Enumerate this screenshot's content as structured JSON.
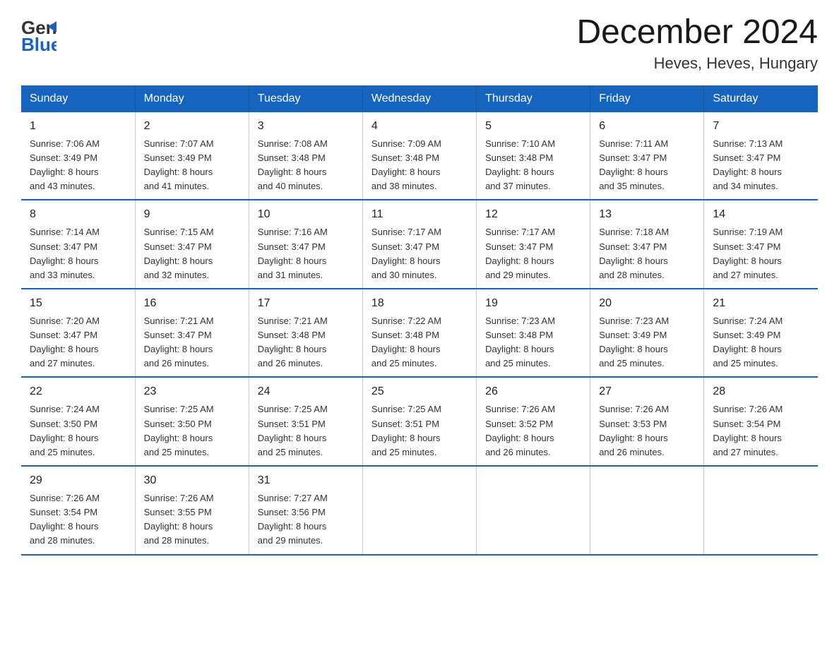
{
  "logo": {
    "line1": "General",
    "line2": "Blue"
  },
  "title": "December 2024",
  "subtitle": "Heves, Heves, Hungary",
  "columns": [
    "Sunday",
    "Monday",
    "Tuesday",
    "Wednesday",
    "Thursday",
    "Friday",
    "Saturday"
  ],
  "weeks": [
    [
      {
        "day": "1",
        "sunrise": "7:06 AM",
        "sunset": "3:49 PM",
        "daylight": "8 hours and 43 minutes."
      },
      {
        "day": "2",
        "sunrise": "7:07 AM",
        "sunset": "3:49 PM",
        "daylight": "8 hours and 41 minutes."
      },
      {
        "day": "3",
        "sunrise": "7:08 AM",
        "sunset": "3:48 PM",
        "daylight": "8 hours and 40 minutes."
      },
      {
        "day": "4",
        "sunrise": "7:09 AM",
        "sunset": "3:48 PM",
        "daylight": "8 hours and 38 minutes."
      },
      {
        "day": "5",
        "sunrise": "7:10 AM",
        "sunset": "3:48 PM",
        "daylight": "8 hours and 37 minutes."
      },
      {
        "day": "6",
        "sunrise": "7:11 AM",
        "sunset": "3:47 PM",
        "daylight": "8 hours and 35 minutes."
      },
      {
        "day": "7",
        "sunrise": "7:13 AM",
        "sunset": "3:47 PM",
        "daylight": "8 hours and 34 minutes."
      }
    ],
    [
      {
        "day": "8",
        "sunrise": "7:14 AM",
        "sunset": "3:47 PM",
        "daylight": "8 hours and 33 minutes."
      },
      {
        "day": "9",
        "sunrise": "7:15 AM",
        "sunset": "3:47 PM",
        "daylight": "8 hours and 32 minutes."
      },
      {
        "day": "10",
        "sunrise": "7:16 AM",
        "sunset": "3:47 PM",
        "daylight": "8 hours and 31 minutes."
      },
      {
        "day": "11",
        "sunrise": "7:17 AM",
        "sunset": "3:47 PM",
        "daylight": "8 hours and 30 minutes."
      },
      {
        "day": "12",
        "sunrise": "7:17 AM",
        "sunset": "3:47 PM",
        "daylight": "8 hours and 29 minutes."
      },
      {
        "day": "13",
        "sunrise": "7:18 AM",
        "sunset": "3:47 PM",
        "daylight": "8 hours and 28 minutes."
      },
      {
        "day": "14",
        "sunrise": "7:19 AM",
        "sunset": "3:47 PM",
        "daylight": "8 hours and 27 minutes."
      }
    ],
    [
      {
        "day": "15",
        "sunrise": "7:20 AM",
        "sunset": "3:47 PM",
        "daylight": "8 hours and 27 minutes."
      },
      {
        "day": "16",
        "sunrise": "7:21 AM",
        "sunset": "3:47 PM",
        "daylight": "8 hours and 26 minutes."
      },
      {
        "day": "17",
        "sunrise": "7:21 AM",
        "sunset": "3:48 PM",
        "daylight": "8 hours and 26 minutes."
      },
      {
        "day": "18",
        "sunrise": "7:22 AM",
        "sunset": "3:48 PM",
        "daylight": "8 hours and 25 minutes."
      },
      {
        "day": "19",
        "sunrise": "7:23 AM",
        "sunset": "3:48 PM",
        "daylight": "8 hours and 25 minutes."
      },
      {
        "day": "20",
        "sunrise": "7:23 AM",
        "sunset": "3:49 PM",
        "daylight": "8 hours and 25 minutes."
      },
      {
        "day": "21",
        "sunrise": "7:24 AM",
        "sunset": "3:49 PM",
        "daylight": "8 hours and 25 minutes."
      }
    ],
    [
      {
        "day": "22",
        "sunrise": "7:24 AM",
        "sunset": "3:50 PM",
        "daylight": "8 hours and 25 minutes."
      },
      {
        "day": "23",
        "sunrise": "7:25 AM",
        "sunset": "3:50 PM",
        "daylight": "8 hours and 25 minutes."
      },
      {
        "day": "24",
        "sunrise": "7:25 AM",
        "sunset": "3:51 PM",
        "daylight": "8 hours and 25 minutes."
      },
      {
        "day": "25",
        "sunrise": "7:25 AM",
        "sunset": "3:51 PM",
        "daylight": "8 hours and 25 minutes."
      },
      {
        "day": "26",
        "sunrise": "7:26 AM",
        "sunset": "3:52 PM",
        "daylight": "8 hours and 26 minutes."
      },
      {
        "day": "27",
        "sunrise": "7:26 AM",
        "sunset": "3:53 PM",
        "daylight": "8 hours and 26 minutes."
      },
      {
        "day": "28",
        "sunrise": "7:26 AM",
        "sunset": "3:54 PM",
        "daylight": "8 hours and 27 minutes."
      }
    ],
    [
      {
        "day": "29",
        "sunrise": "7:26 AM",
        "sunset": "3:54 PM",
        "daylight": "8 hours and 28 minutes."
      },
      {
        "day": "30",
        "sunrise": "7:26 AM",
        "sunset": "3:55 PM",
        "daylight": "8 hours and 28 minutes."
      },
      {
        "day": "31",
        "sunrise": "7:27 AM",
        "sunset": "3:56 PM",
        "daylight": "8 hours and 29 minutes."
      },
      null,
      null,
      null,
      null
    ]
  ],
  "labels": {
    "sunrise": "Sunrise:",
    "sunset": "Sunset:",
    "daylight": "Daylight:"
  }
}
